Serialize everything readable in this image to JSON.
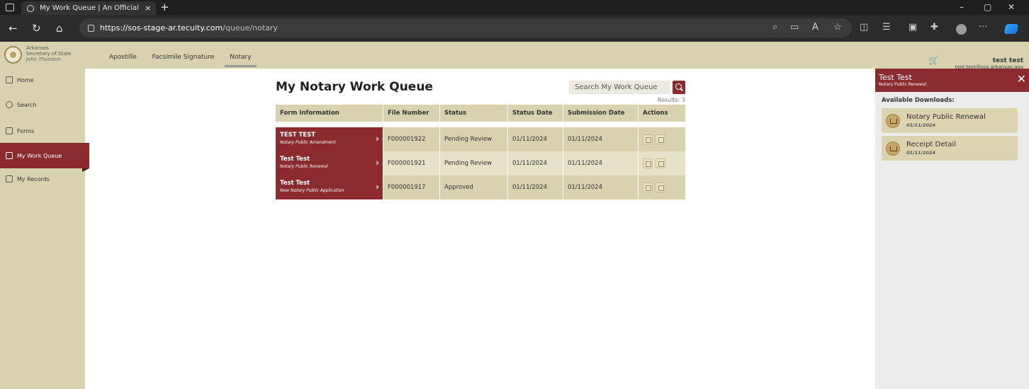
{
  "browser": {
    "tab_title": "My Work Queue | An Official Ark",
    "tab_close": "×",
    "new_tab": "+",
    "url_host": "https://sos-stage-ar.tecuity.com",
    "url_path": "/queue/notary",
    "win_min": "–",
    "win_max": "▢",
    "win_close": "✕",
    "more": "···"
  },
  "app": {
    "brand_line1": "Arkansas",
    "brand_line2": "Secretary of State",
    "brand_name": "John Thurston",
    "top_nav": [
      "Apostille",
      "Facsimile Signature",
      "Notary"
    ],
    "user_name": "test test",
    "user_email": "test.test@sos.arkansas.gov"
  },
  "sidebar": {
    "items": [
      {
        "label": "Home"
      },
      {
        "label": "Search"
      },
      {
        "label": "Forms"
      },
      {
        "label": "My Work Queue"
      },
      {
        "label": "My Records"
      }
    ]
  },
  "main": {
    "title": "My Notary Work Queue",
    "search_placeholder": "Search My Work Queue",
    "results": "Results: 3",
    "headers": [
      "Form Information",
      "File Number",
      "Status",
      "Status Date",
      "Submission Date",
      "Actions"
    ],
    "rows": [
      {
        "name": "TEST TEST",
        "type": "Notary Public Amendment",
        "file": "F000001922",
        "status": "Pending Review",
        "status_date": "01/11/2024",
        "submission_date": "01/11/2024"
      },
      {
        "name": "Test Test",
        "type": "Notary Public Renewal",
        "file": "F000001921",
        "status": "Pending Review",
        "status_date": "01/11/2024",
        "submission_date": "01/11/2024"
      },
      {
        "name": "Test Test",
        "type": "New Notary Public Application",
        "file": "F000001917",
        "status": "Approved",
        "status_date": "01/11/2024",
        "submission_date": "01/11/2024"
      }
    ]
  },
  "panel": {
    "title": "Test Test",
    "subtitle": "Notary Public Renewal",
    "close": "✕",
    "available_label": "Available Downloads:",
    "downloads": [
      {
        "name": "Notary Public Renewal",
        "date": "01/11/2024"
      },
      {
        "name": "Receipt Detail",
        "date": "01/11/2024"
      }
    ]
  },
  "colors": {
    "brand_maroon": "#8b2a2f",
    "tan": "#d9d2b0"
  }
}
